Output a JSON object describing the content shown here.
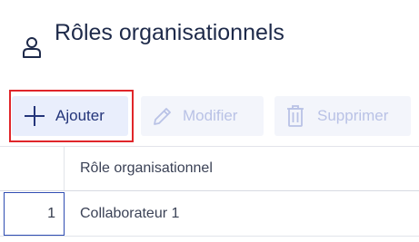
{
  "page": {
    "title": "Rôles organisationnels"
  },
  "toolbar": {
    "add_label": "Ajouter",
    "edit_label": "Modifier",
    "delete_label": "Supprimer",
    "highlight_color": "#e0262a"
  },
  "table": {
    "columns": [
      "",
      "Rôle organisationnel"
    ],
    "rows": [
      {
        "index": "1",
        "role": "Collaborateur 1"
      }
    ]
  },
  "icons": {
    "title": "person-icon",
    "add": "plus-icon",
    "edit": "pencil-icon",
    "delete": "trash-icon"
  },
  "colors": {
    "title": "#1e2a4a",
    "primary_button_bg": "#e9eefc",
    "primary_button_text": "#24357a",
    "disabled_text": "#b9c2e6",
    "selected_cell_border": "#2f4db2"
  }
}
